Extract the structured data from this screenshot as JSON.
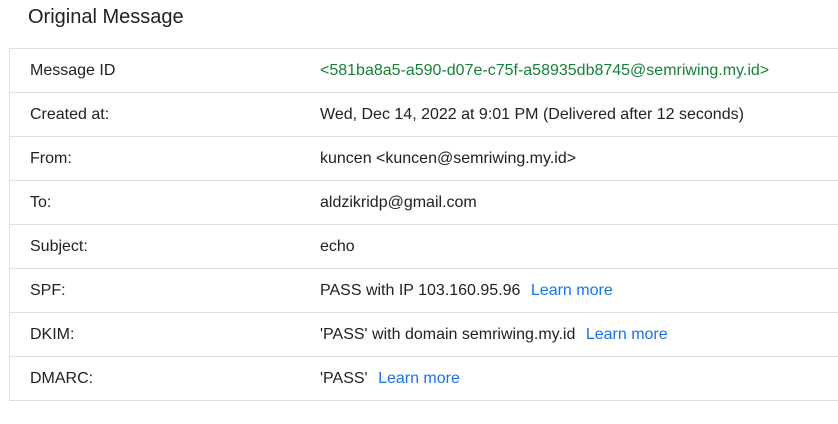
{
  "title": "Original Message",
  "rows": [
    {
      "label": "Message ID",
      "value": "<581ba8a5-a590-d07e-c75f-a58935db8745@semriwing.my.id>"
    },
    {
      "label": "Created at:",
      "value": "Wed, Dec 14, 2022 at 9:01 PM (Delivered after 12 seconds)"
    },
    {
      "label": "From:",
      "value": "kuncen <kuncen@semriwing.my.id>"
    },
    {
      "label": "To:",
      "value": "aldzikridp@gmail.com"
    },
    {
      "label": "Subject:",
      "value": "echo"
    },
    {
      "label": "SPF:",
      "value": "PASS with IP 103.160.95.96",
      "link": "Learn more"
    },
    {
      "label": "DKIM:",
      "value": "'PASS' with domain semriwing.my.id",
      "link": "Learn more"
    },
    {
      "label": "DMARC:",
      "value": "'PASS'",
      "link": "Learn more"
    }
  ],
  "colors": {
    "message_id": "#188038",
    "link": "#1a73e8",
    "border": "#e0e0e0"
  }
}
